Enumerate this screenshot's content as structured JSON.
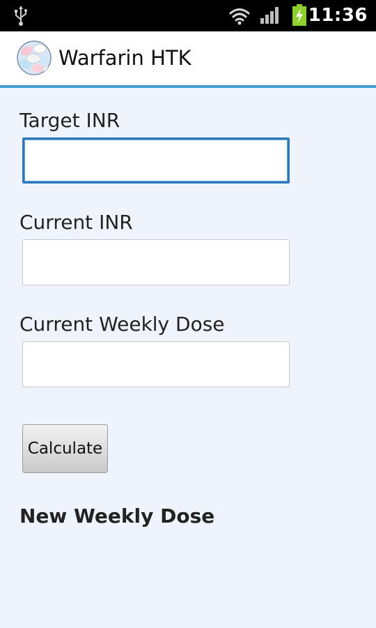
{
  "status_bar": {
    "time": "11:36",
    "icons": [
      "usb-icon",
      "wifi-icon",
      "signal-icon",
      "battery-charging-icon"
    ]
  },
  "app": {
    "title": "Warfarin HTK",
    "icon": "pills-icon"
  },
  "form": {
    "target_inr": {
      "label": "Target INR",
      "value": "",
      "placeholder": ""
    },
    "current_inr": {
      "label": "Current INR",
      "value": "",
      "placeholder": ""
    },
    "weekly_dose": {
      "label": "Current Weekly Dose",
      "value": "",
      "placeholder": ""
    },
    "calculate_label": "Calculate",
    "result_heading": "New Weekly Dose"
  },
  "colors": {
    "background": "#eef3fc",
    "accent": "#3f9ccd",
    "focus": "#2f78b8",
    "battery": "#8ed12f"
  }
}
